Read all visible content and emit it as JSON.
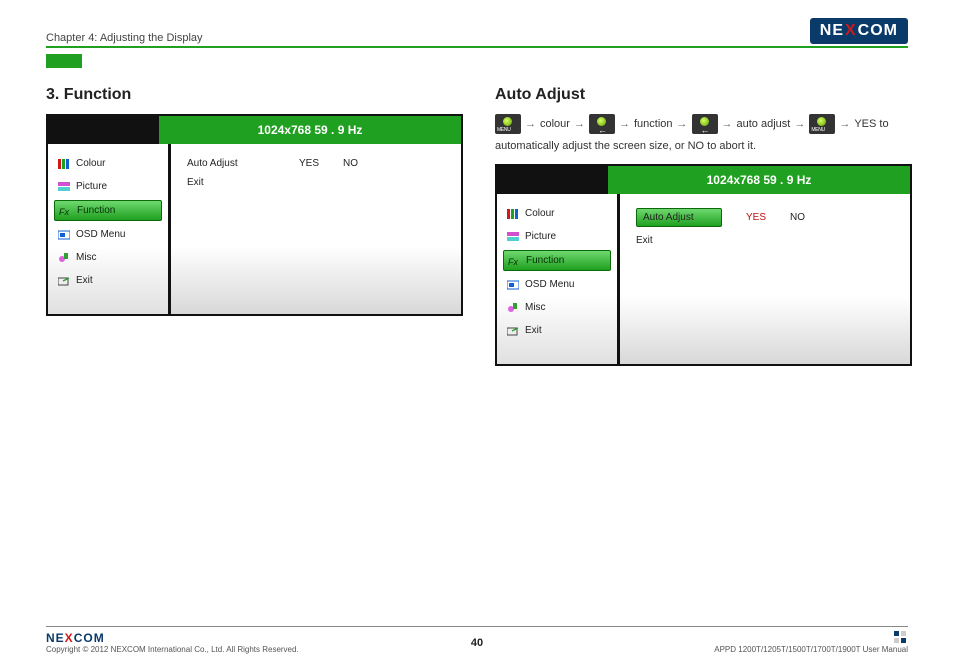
{
  "header": {
    "chapter": "Chapter 4: Adjusting the Display",
    "brand_pre": "NE",
    "brand_x": "X",
    "brand_post": "COM"
  },
  "left": {
    "title": "3. Function",
    "osd_title": "1024x768  59  . 9 Hz",
    "side": {
      "colour": "Colour",
      "picture": "Picture",
      "function": "Function",
      "osdmenu": "OSD Menu",
      "misc": "Misc",
      "exit": "Exit"
    },
    "main": {
      "autoadjust": "Auto Adjust",
      "yes": "YES",
      "no": "NO",
      "exit": "Exit"
    }
  },
  "right": {
    "title": "Auto Adjust",
    "crumbs": {
      "c1": "colour",
      "c2": "function",
      "c3": "auto adjust",
      "c4": "YES to"
    },
    "crumbs_cont": "automatically adjust the screen size, or NO to abort it.",
    "osd_title": "1024x768  59  . 9 Hz",
    "side": {
      "colour": "Colour",
      "picture": "Picture",
      "function": "Function",
      "osdmenu": "OSD Menu",
      "misc": "Misc",
      "exit": "Exit"
    },
    "main": {
      "autoadjust": "Auto Adjust",
      "yes": "YES",
      "no": "NO",
      "exit": "Exit"
    }
  },
  "footer": {
    "copyright": "Copyright © 2012 NEXCOM International Co., Ltd. All Rights Reserved.",
    "page": "40",
    "model": "APPD 1200T/1205T/1500T/1700T/1900T User Manual"
  }
}
